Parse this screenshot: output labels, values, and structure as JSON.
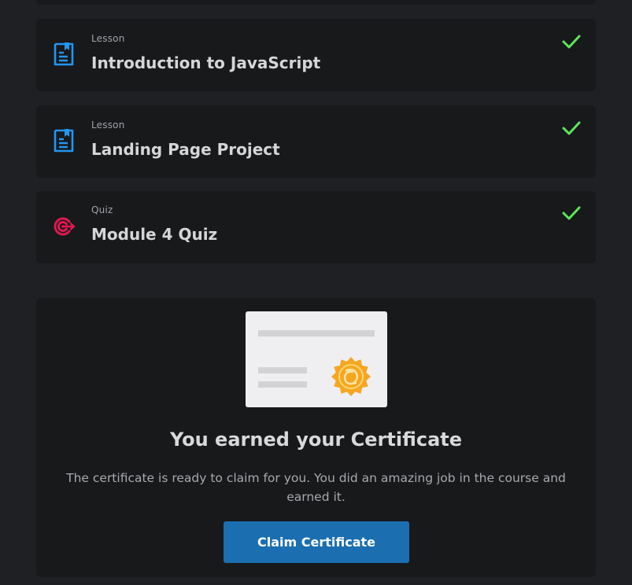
{
  "items": [
    {
      "type": "Lesson",
      "title": "Introduction to JavaScript",
      "icon": "document-icon",
      "completed": true
    },
    {
      "type": "Lesson",
      "title": "Landing Page Project",
      "icon": "document-icon",
      "completed": true
    },
    {
      "type": "Quiz",
      "title": "Module 4 Quiz",
      "icon": "target-icon",
      "completed": true
    }
  ],
  "certificate": {
    "title": "You earned your Certificate",
    "description": "The certificate is ready to claim for you. You did an amazing job in the course and earned it.",
    "button_label": "Claim Certificate"
  },
  "colors": {
    "background": "#1f2023",
    "card": "#18191b",
    "lesson_icon": "#2196f3",
    "quiz_icon": "#e0194f",
    "check": "#5ee65a",
    "button": "#1b6fb0",
    "seal": "#f5a623"
  }
}
